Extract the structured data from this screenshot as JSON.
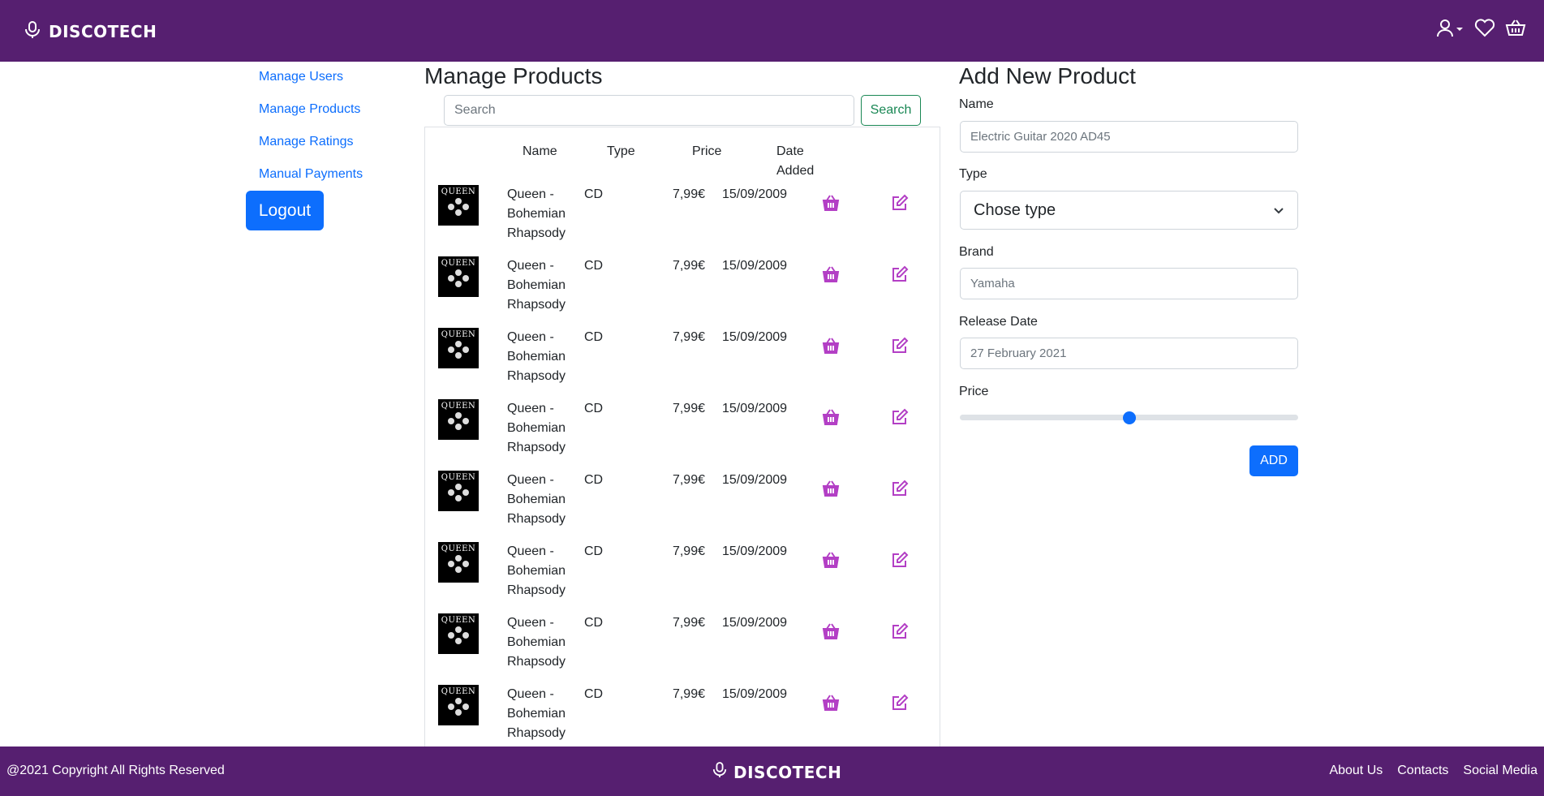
{
  "header": {
    "brand": "DISCOTECH",
    "icons": [
      "microphone-icon",
      "user-icon",
      "heart-icon",
      "basket-icon"
    ]
  },
  "sidebar": {
    "items": [
      {
        "label": "Manage Users"
      },
      {
        "label": "Manage Products"
      },
      {
        "label": "Manage Ratings"
      },
      {
        "label": "Manual Payments"
      }
    ],
    "logout_label": "Logout"
  },
  "products": {
    "title": "Manage Products",
    "search": {
      "placeholder": "Search",
      "button_label": "Search"
    },
    "columns": {
      "name": "Name",
      "type": "Type",
      "price": "Price",
      "date": "Date Added"
    },
    "thumb_label": "QUEEN",
    "rows": [
      {
        "name": "Queen - Bohemian Rhapsody",
        "type": "CD",
        "price": "7,99€",
        "date": "15/09/2009"
      },
      {
        "name": "Queen - Bohemian Rhapsody",
        "type": "CD",
        "price": "7,99€",
        "date": "15/09/2009"
      },
      {
        "name": "Queen - Bohemian Rhapsody",
        "type": "CD",
        "price": "7,99€",
        "date": "15/09/2009"
      },
      {
        "name": "Queen - Bohemian Rhapsody",
        "type": "CD",
        "price": "7,99€",
        "date": "15/09/2009"
      },
      {
        "name": "Queen - Bohemian Rhapsody",
        "type": "CD",
        "price": "7,99€",
        "date": "15/09/2009"
      },
      {
        "name": "Queen - Bohemian Rhapsody",
        "type": "CD",
        "price": "7,99€",
        "date": "15/09/2009"
      },
      {
        "name": "Queen - Bohemian Rhapsody",
        "type": "CD",
        "price": "7,99€",
        "date": "15/09/2009"
      },
      {
        "name": "Queen - Bohemian Rhapsody",
        "type": "CD",
        "price": "7,99€",
        "date": "15/09/2009"
      }
    ]
  },
  "form": {
    "title": "Add New Product",
    "name_label": "Name",
    "name_placeholder": "Electric Guitar 2020 AD45",
    "type_label": "Type",
    "type_value": "Chose type",
    "brand_label": "Brand",
    "brand_placeholder": "Yamaha",
    "release_label": "Release Date",
    "release_placeholder": "27 February 2021",
    "price_label": "Price",
    "price_slider_fraction": 0.5,
    "add_label": "ADD"
  },
  "footer": {
    "copyright": "@2021 Copyright All Rights Reserved",
    "brand": "DISCOTECH",
    "links": [
      {
        "label": "About Us"
      },
      {
        "label": "Contacts"
      },
      {
        "label": "Social Media"
      }
    ]
  },
  "colors": {
    "brand_purple": "#561f70",
    "accent_blue": "#0d6efd",
    "icon_magenta": "#b33fc5",
    "search_green": "#198754"
  }
}
